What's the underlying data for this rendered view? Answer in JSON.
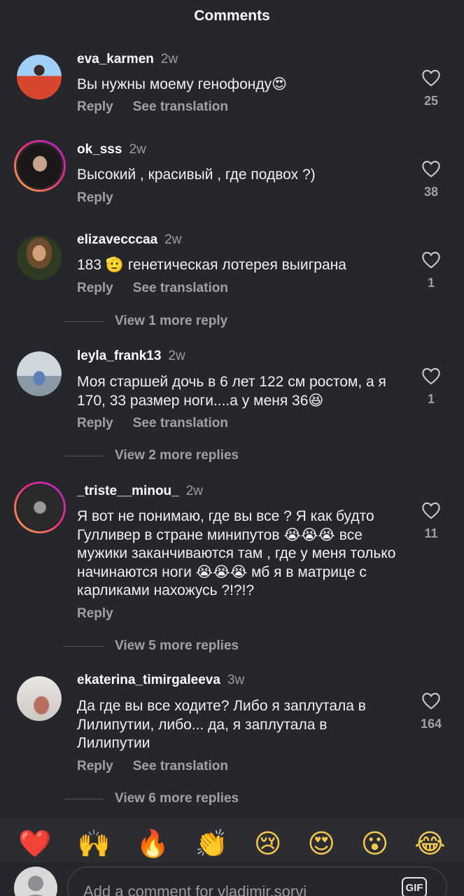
{
  "header": {
    "title": "Comments"
  },
  "labels": {
    "reply": "Reply",
    "see_translation": "See translation"
  },
  "comments": [
    {
      "username": "eva_karmen",
      "time": "2w",
      "text": "Вы нужны моему генофонду😍",
      "likes": "25",
      "has_translation": true
    },
    {
      "username": "ok_sss",
      "time": "2w",
      "text": "Высокий , красивый , где подвох ?)",
      "likes": "38",
      "has_translation": false
    },
    {
      "username": "elizavecccaa",
      "time": "2w",
      "text": "183 🫡 генетическая лотерея выиграна",
      "likes": "1",
      "has_translation": true,
      "more_replies": "View 1 more reply"
    },
    {
      "username": "leyla_frank13",
      "time": "2w",
      "text": "Моя старшей дочь в 6 лет 122 см ростом, а я 170, 33 размер ноги....а у меня 36😆",
      "likes": "1",
      "has_translation": true,
      "more_replies": "View 2 more replies"
    },
    {
      "username": "_triste__minou_",
      "time": "2w",
      "text": "Я вот не понимаю, где вы все ? Я как будто Гулливер в стране минипутов 😭😭😭 все мужики заканчиваются там , где у меня только начинаются ноги 😭😭😭 мб я в матрице с карликами нахожусь ?!?!?",
      "likes": "11",
      "has_translation": false,
      "more_replies": "View 5 more replies"
    },
    {
      "username": "ekaterina_timirgaleeva",
      "time": "3w",
      "text": "Да где вы все ходите? Либо я заплутала в Лилипутии, либо... да, я заплутала в Лилипутии",
      "likes": "164",
      "has_translation": true,
      "more_replies": "View 6 more replies"
    }
  ],
  "emoji_bar": [
    "❤️",
    "🙌",
    "🔥",
    "👏",
    "😢",
    "😍",
    "😮",
    "😂"
  ],
  "composer": {
    "placeholder": "Add a comment for vladimir.sorvi",
    "gif_label": "GIF"
  },
  "colors": {
    "background": "#26272c",
    "muted": "#a0a1a7",
    "ring": "#ee2a7b"
  }
}
